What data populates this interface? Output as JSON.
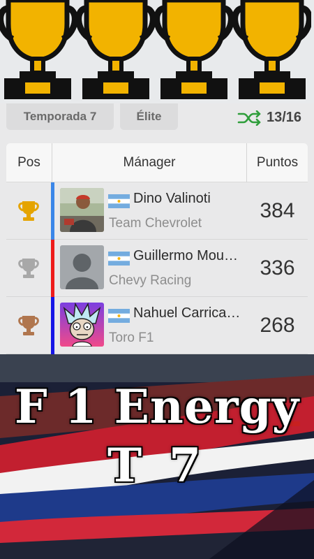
{
  "filters": {
    "season_label": "Temporada 7",
    "league_label": "Élite",
    "round_count": "13/16",
    "shuffle_icon": "shuffle-icon"
  },
  "table": {
    "headers": {
      "pos": "Pos",
      "manager": "Mánager",
      "points": "Puntos"
    },
    "rows": [
      {
        "manager": "Dino Valinoti",
        "team": "Team Chevrolet",
        "points": "384",
        "trophy": "gold",
        "bar_color": "#3a86e8",
        "avatar": "photo"
      },
      {
        "manager": "Guillermo Mourelle",
        "team": "Chevy Racing",
        "points": "336",
        "trophy": "silver",
        "bar_color": "#ee1c1c",
        "avatar": "placeholder"
      },
      {
        "manager": "Nahuel Carricaburu",
        "team": "Toro F1",
        "points": "268",
        "trophy": "bronze",
        "bar_color": "#1616e6",
        "avatar": "cartoon"
      }
    ]
  },
  "banner": {
    "line1": "F 1 Energy",
    "line2": "T 7"
  },
  "colors": {
    "gold": "#e5a400",
    "silver": "#a8a8a8",
    "bronze": "#b0764e",
    "flag_blue": "#74acdf"
  }
}
